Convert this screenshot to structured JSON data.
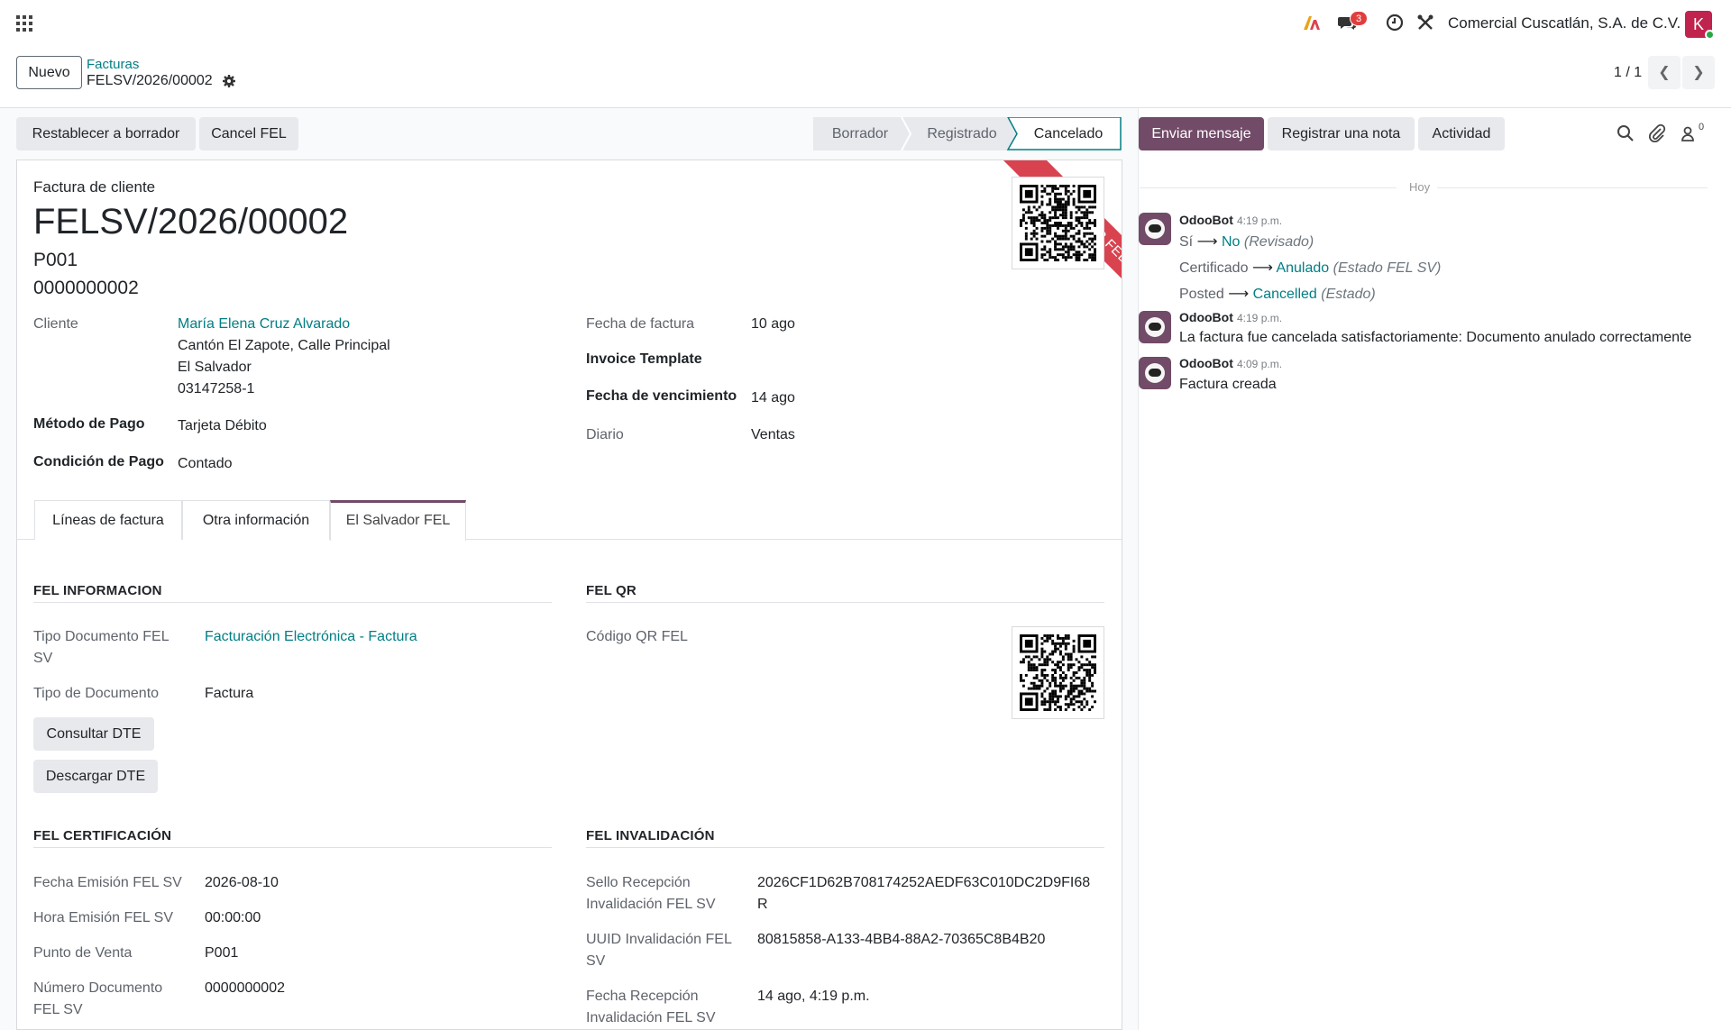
{
  "navbar": {
    "apps_icon": "grid-icon",
    "messages_count": "3",
    "company": "Comercial Cuscatlán, S.A. de C.V.",
    "avatar_letter": "K"
  },
  "control": {
    "new_label": "Nuevo",
    "breadcrumb_parent": "Facturas",
    "breadcrumb_current": "FELSV/2026/00002",
    "pager": "1 / 1"
  },
  "actions": {
    "reset_draft": "Restablecer a borrador",
    "cancel_fel": "Cancel FEL"
  },
  "status": {
    "stages": [
      "Borrador",
      "Registrado",
      "Cancelado"
    ],
    "active": "Cancelado"
  },
  "invoice": {
    "type": "Factura de cliente",
    "name": "FELSV/2026/00002",
    "pos": "P001",
    "number": "0000000002",
    "ribbon": "CANCELAR FEL",
    "customer_label": "Cliente",
    "customer_name": "María Elena Cruz Alvarado",
    "customer_addr1": "Cantón El Zapote, Calle Principal",
    "customer_addr2": "El Salvador",
    "customer_addr3": "03147258-1",
    "payment_method_label": "Método de Pago",
    "payment_method": "Tarjeta Débito",
    "payment_cond_label": "Condición de Pago",
    "payment_cond": "Contado",
    "invoice_date_label": "Fecha de factura",
    "invoice_date": "10 ago",
    "template_label": "Invoice Template",
    "due_date_label": "Fecha de vencimiento",
    "due_date": "14 ago",
    "journal_label": "Diario",
    "journal": "Ventas"
  },
  "tabs": [
    "Líneas de factura",
    "Otra información",
    "El Salvador FEL"
  ],
  "fel": {
    "info_title": "FEL INFORMACION",
    "doc_type_fel_label_1": "Tipo Documento FEL",
    "doc_type_fel_label_2": "SV",
    "doc_type_fel": "Facturación Electrónica - Factura",
    "doc_type_label": "Tipo de Documento",
    "doc_type": "Factura",
    "consult_btn": "Consultar DTE",
    "download_btn": "Descargar DTE",
    "qr_title": "FEL QR",
    "qr_label": "Código QR FEL",
    "cert_title": "FEL CERTIFICACIÓN",
    "emission_date_label": "Fecha Emisión FEL SV",
    "emission_date": "2026-08-10",
    "emission_time_label": "Hora Emisión FEL SV",
    "emission_time": "00:00:00",
    "pos_label": "Punto de Venta",
    "pos": "P001",
    "doc_num_label_1": "Número Documento",
    "doc_num_label_2": "FEL SV",
    "doc_num": "0000000002",
    "inval_title": "FEL INVALIDACIÓN",
    "seal_label_1": "Sello Recepción",
    "seal_label_2": "Invalidación FEL SV",
    "seal_1": "2026CF1D62B708174252AEDF63C010DC2D9FI68",
    "seal_2": "R",
    "uuid_label_1": "UUID Invalidación FEL",
    "uuid_label_2": "SV",
    "uuid": "80815858-A133-4BB4-88A2-70365C8B4B20",
    "recv_date_label_1": "Fecha Recepción",
    "recv_date_label_2": "Invalidación FEL SV",
    "recv_date": "14 ago, 4:19 p.m."
  },
  "chatter": {
    "send_message": "Enviar mensaje",
    "log_note": "Registrar una nota",
    "activity": "Actividad",
    "followers_count": "0",
    "day": "Hoy",
    "messages": [
      {
        "author": "OdooBot",
        "time": "4:19 p.m.",
        "tracking": [
          {
            "old": "Sí",
            "new": "No",
            "field": "(Revisado)"
          },
          {
            "old": "Certificado",
            "new": "Anulado",
            "field": "(Estado FEL SV)"
          },
          {
            "old": "Posted",
            "new": "Cancelled",
            "field": "(Estado)"
          }
        ]
      },
      {
        "author": "OdooBot",
        "time": "4:19 p.m.",
        "body": "La factura fue cancelada satisfactoriamente: Documento anulado correctamente"
      },
      {
        "author": "OdooBot",
        "time": "4:09 p.m.",
        "body": "Factura creada"
      }
    ]
  },
  "colors": {
    "brand": "#714b67",
    "link": "#017e84",
    "ribbon": "#d9434f"
  }
}
